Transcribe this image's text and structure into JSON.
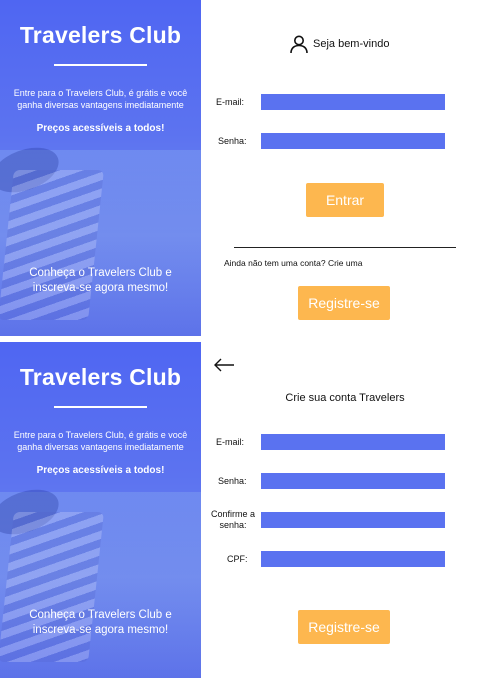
{
  "brand": {
    "title": "Travelers Club",
    "description": "Entre para o Travelers Club, é grátis e você ganha diversas vantagens imediatamente",
    "prices": "Preços acessíveis a todos!",
    "cta": "Conheça o Travelers Club e inscreva-se agora mesmo!"
  },
  "login": {
    "welcome": "Seja bem-vindo",
    "email_label": "E-mail:",
    "password_label": "Senha:",
    "submit_label": "Entrar",
    "no_account_text": "Ainda não tem uma conta? Crie uma",
    "register_label": "Registre-se"
  },
  "signup": {
    "title": "Crie sua conta Travelers",
    "email_label": "E-mail:",
    "password_label": "Senha:",
    "confirm_label": "Confirme a senha:",
    "cpf_label": "CPF:",
    "register_label": "Registre-se"
  },
  "icons": {
    "user": "user-icon",
    "back": "arrow-left-icon"
  },
  "colors": {
    "brand_blue": "#5a72f0",
    "button_orange": "#fdb74f"
  }
}
